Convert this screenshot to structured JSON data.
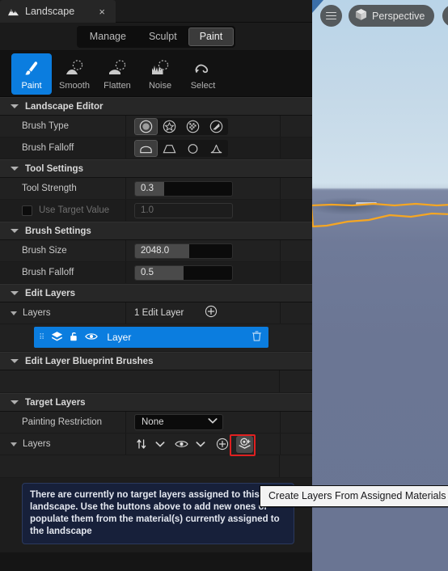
{
  "window": {
    "tab_title": "Landscape",
    "tab_close_label": "×"
  },
  "modes": {
    "items": [
      {
        "label": "Manage",
        "active": false
      },
      {
        "label": "Sculpt",
        "active": false
      },
      {
        "label": "Paint",
        "active": true
      }
    ]
  },
  "tools": {
    "items": [
      {
        "label": "Paint",
        "icon": "brush-icon",
        "active": true
      },
      {
        "label": "Smooth",
        "icon": "smooth-icon",
        "active": false
      },
      {
        "label": "Flatten",
        "icon": "flatten-icon",
        "active": false
      },
      {
        "label": "Noise",
        "icon": "noise-icon",
        "active": false
      },
      {
        "label": "Select",
        "icon": "select-icon",
        "active": false
      }
    ]
  },
  "landscape_editor": {
    "title": "Landscape Editor",
    "brush_type": {
      "label": "Brush Type",
      "options": [
        "circle-brush-icon",
        "pattern-brush-icon",
        "component-brush-icon",
        "gizmo-brush-icon"
      ],
      "selected_index": 0
    },
    "brush_falloff": {
      "label": "Brush Falloff",
      "options": [
        "smooth-falloff-icon",
        "linear-falloff-icon",
        "spherical-falloff-icon",
        "tip-falloff-icon"
      ],
      "selected_index": 0
    }
  },
  "tool_settings": {
    "title": "Tool Settings",
    "tool_strength": {
      "label": "Tool Strength",
      "value": "0.3",
      "fill_percent": 30
    },
    "use_target_value": {
      "label": "Use Target Value",
      "checked": false,
      "value": "1.0",
      "enabled": false
    }
  },
  "brush_settings": {
    "title": "Brush Settings",
    "brush_size": {
      "label": "Brush Size",
      "value": "2048.0",
      "fill_percent": 56
    },
    "brush_falloff": {
      "label": "Brush Falloff",
      "value": "0.5",
      "fill_percent": 50
    }
  },
  "edit_layers": {
    "title": "Edit Layers",
    "layers_row": {
      "label": "Layers",
      "count_text": "1 Edit Layer",
      "add_icon": "plus-circle-icon"
    },
    "layer_item": {
      "name": "Layer",
      "grip_icon": "drag-grip-icon",
      "stack_icon": "layer-stack-icon",
      "lock_icon": "unlocked-padlock-icon",
      "visibility_icon": "eye-icon",
      "delete_icon": "trash-icon"
    },
    "blueprint_brushes_title": "Edit Layer Blueprint Brushes"
  },
  "target_layers": {
    "title": "Target Layers",
    "painting_restriction": {
      "label": "Painting Restriction",
      "value": "None",
      "chevron": "chevron-down-icon"
    },
    "layers_row": {
      "label": "Layers",
      "buttons": [
        {
          "icon": "sort-arrows-icon",
          "highlighted": false
        },
        {
          "icon": "chevron-down-icon",
          "highlighted": false
        },
        {
          "icon": "eye-icon",
          "highlighted": false
        },
        {
          "icon": "chevron-down-icon",
          "highlighted": false
        },
        {
          "icon": "plus-circle-icon",
          "highlighted": false
        },
        {
          "icon": "create-layers-from-materials-icon",
          "highlighted": true
        }
      ]
    },
    "empty_message": "There are currently no target layers assigned to this landscape. Use the buttons above to add new ones or populate them from the material(s) currently assigned to the landscape"
  },
  "tooltip": {
    "text": "Create Layers From Assigned Materials"
  },
  "viewport": {
    "menu_icon": "hamburger-menu-icon",
    "camera_mode": {
      "label": "Perspective",
      "icon": "cube-icon"
    },
    "extra_button_icon": "lighting-mode-icon",
    "selection_outline_color": "#f5a623"
  },
  "colors": {
    "accent_blue": "#0b7ddf",
    "highlight_red": "#e02020",
    "panel_bg": "#212121",
    "section_bg": "#272727",
    "info_bg": "#17203a"
  }
}
